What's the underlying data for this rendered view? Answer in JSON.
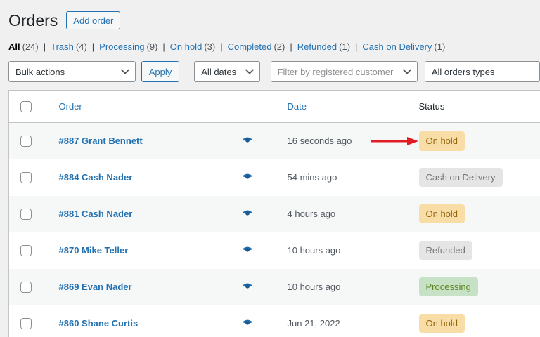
{
  "page": {
    "title": "Orders",
    "add_order_label": "Add order"
  },
  "filters": {
    "items": [
      {
        "label": "All",
        "count": "(24)",
        "current": true
      },
      {
        "label": "Trash",
        "count": "(4)",
        "current": false
      },
      {
        "label": "Processing",
        "count": "(9)",
        "current": false
      },
      {
        "label": "On hold",
        "count": "(3)",
        "current": false
      },
      {
        "label": "Completed",
        "count": "(2)",
        "current": false
      },
      {
        "label": "Refunded",
        "count": "(1)",
        "current": false
      },
      {
        "label": "Cash on Delivery",
        "count": "(1)",
        "current": false
      }
    ]
  },
  "toolbar": {
    "bulk_actions_selected": "Bulk actions",
    "apply_label": "Apply",
    "dates_selected": "All dates",
    "customer_filter_placeholder": "Filter by registered customer",
    "order_types_selected": "All orders types"
  },
  "table": {
    "columns": {
      "order": "Order",
      "date": "Date",
      "status": "Status"
    },
    "rows": [
      {
        "order": "#887 Grant Bennett",
        "date": "16 seconds ago",
        "status": "On hold",
        "status_type": "on-hold",
        "annotated": true
      },
      {
        "order": "#884 Cash Nader",
        "date": "54 mins ago",
        "status": "Cash on Delivery",
        "status_type": "gray",
        "annotated": false
      },
      {
        "order": "#881 Cash Nader",
        "date": "4 hours ago",
        "status": "On hold",
        "status_type": "on-hold",
        "annotated": false
      },
      {
        "order": "#870 Mike Teller",
        "date": "10 hours ago",
        "status": "Refunded",
        "status_type": "gray",
        "annotated": false
      },
      {
        "order": "#869 Evan Nader",
        "date": "10 hours ago",
        "status": "Processing",
        "status_type": "processing",
        "annotated": false
      },
      {
        "order": "#860 Shane Curtis",
        "date": "Jun 21, 2022",
        "status": "On hold",
        "status_type": "on-hold",
        "annotated": false
      }
    ]
  },
  "icons": {
    "preview": "eye-icon",
    "select_arrow": "chevron-down-icon",
    "annotation": "red-right-arrow-icon"
  },
  "colors": {
    "link_blue": "#2271b1",
    "page_bg": "#f0f0f1",
    "table_border": "#c3c4c7",
    "alt_row_bg": "#f6f7f7",
    "status_on_hold_bg": "#f8dda7",
    "status_on_hold_text": "#94660c",
    "status_processing_bg": "#c6e1c6",
    "status_processing_text": "#5b841b",
    "status_gray_bg": "#e5e5e5",
    "status_gray_text": "#777777",
    "annotation_arrow_red": "#e11c24"
  }
}
